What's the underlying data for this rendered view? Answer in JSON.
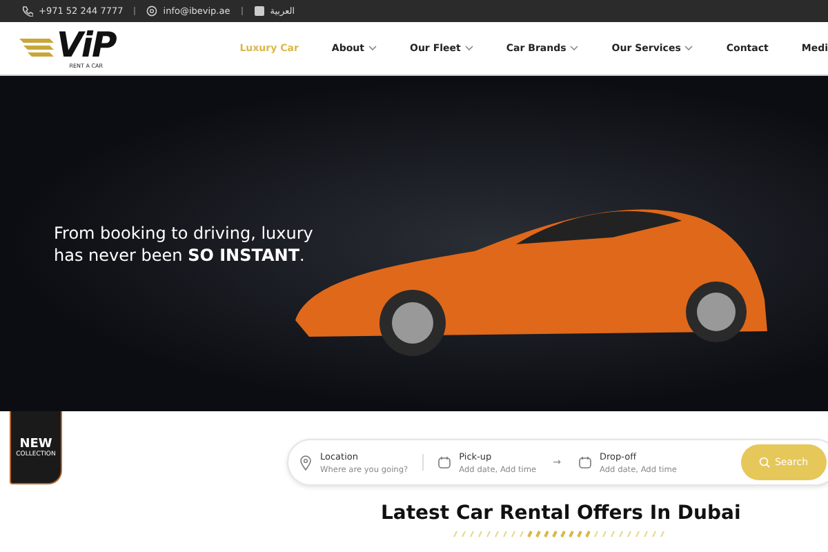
{
  "top_bar": {
    "phone": "+971 52 244 7777",
    "email": "info@ibevip.ae",
    "language": "العربية"
  },
  "logo": {
    "text": "ViP",
    "tagline": "RENT A CAR"
  },
  "nav": [
    {
      "label": "Luxury Car",
      "selected": true,
      "has_menu": false
    },
    {
      "label": "About",
      "selected": false,
      "has_menu": true
    },
    {
      "label": "Our Fleet",
      "selected": false,
      "has_menu": true
    },
    {
      "label": "Car Brands",
      "selected": false,
      "has_menu": true
    },
    {
      "label": "Our Services",
      "selected": false,
      "has_menu": true
    },
    {
      "label": "Contact",
      "selected": false,
      "has_menu": false
    },
    {
      "label": "Medi",
      "selected": false,
      "has_menu": false
    }
  ],
  "hero": {
    "headline": "From booking to driving, luxury has never been **SO INSTANT**."
  },
  "badge": {
    "title": "NEW",
    "subtitle": "COLLECTION"
  },
  "search": {
    "fields": [
      {
        "kind": "location",
        "label": "Location",
        "placeholder": "Where are you going?"
      },
      {
        "kind": "date",
        "label": "Pick-up",
        "placeholder": "Add date, Add time"
      },
      {
        "kind": "date",
        "label": "Drop-off",
        "placeholder": "Add date, Add time"
      }
    ],
    "arrow": "→",
    "button": "Search"
  },
  "section_title": "Latest Car Rental Offers In Dubai"
}
